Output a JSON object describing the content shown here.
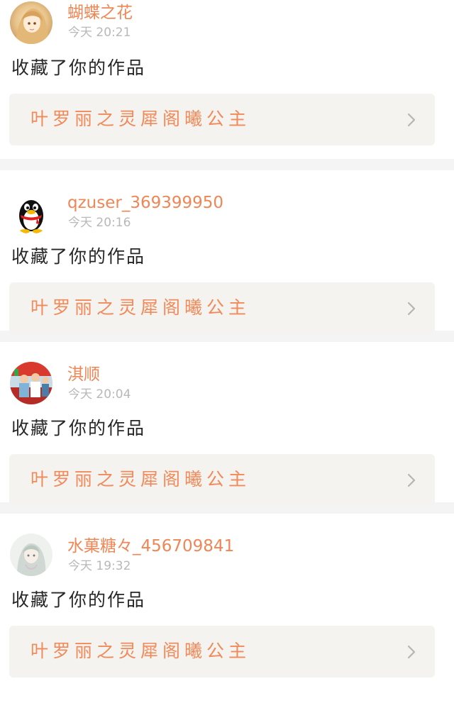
{
  "feed": {
    "items": [
      {
        "username": "蝴蝶之花",
        "time": "今天 20:21",
        "action": "收藏了你的作品",
        "work_title": "叶罗丽之灵犀阁曦公主",
        "avatar": "anime-girl-avatar"
      },
      {
        "username": "qzuser_369399950",
        "time": "今天 20:16",
        "action": "收藏了你的作品",
        "work_title": "叶罗丽之灵犀阁曦公主",
        "avatar": "qq-penguin-avatar"
      },
      {
        "username": "淇顺",
        "time": "今天 20:04",
        "action": "收藏了你的作品",
        "work_title": "叶罗丽之灵犀阁曦公主",
        "avatar": "children-photo-avatar"
      },
      {
        "username": "水菓糖々_456709841",
        "time": "今天 19:32",
        "action": "收藏了你的作品",
        "work_title": "叶罗丽之灵犀阁曦公主",
        "avatar": "anime-fairy-avatar"
      }
    ]
  },
  "colors": {
    "accent": "#ee8656",
    "time": "#b8b8b8",
    "text": "#262626",
    "link_bg": "#f4f3ef",
    "separator": "#f4f4f4"
  },
  "icons": {
    "chevron": "chevron-right-icon"
  }
}
